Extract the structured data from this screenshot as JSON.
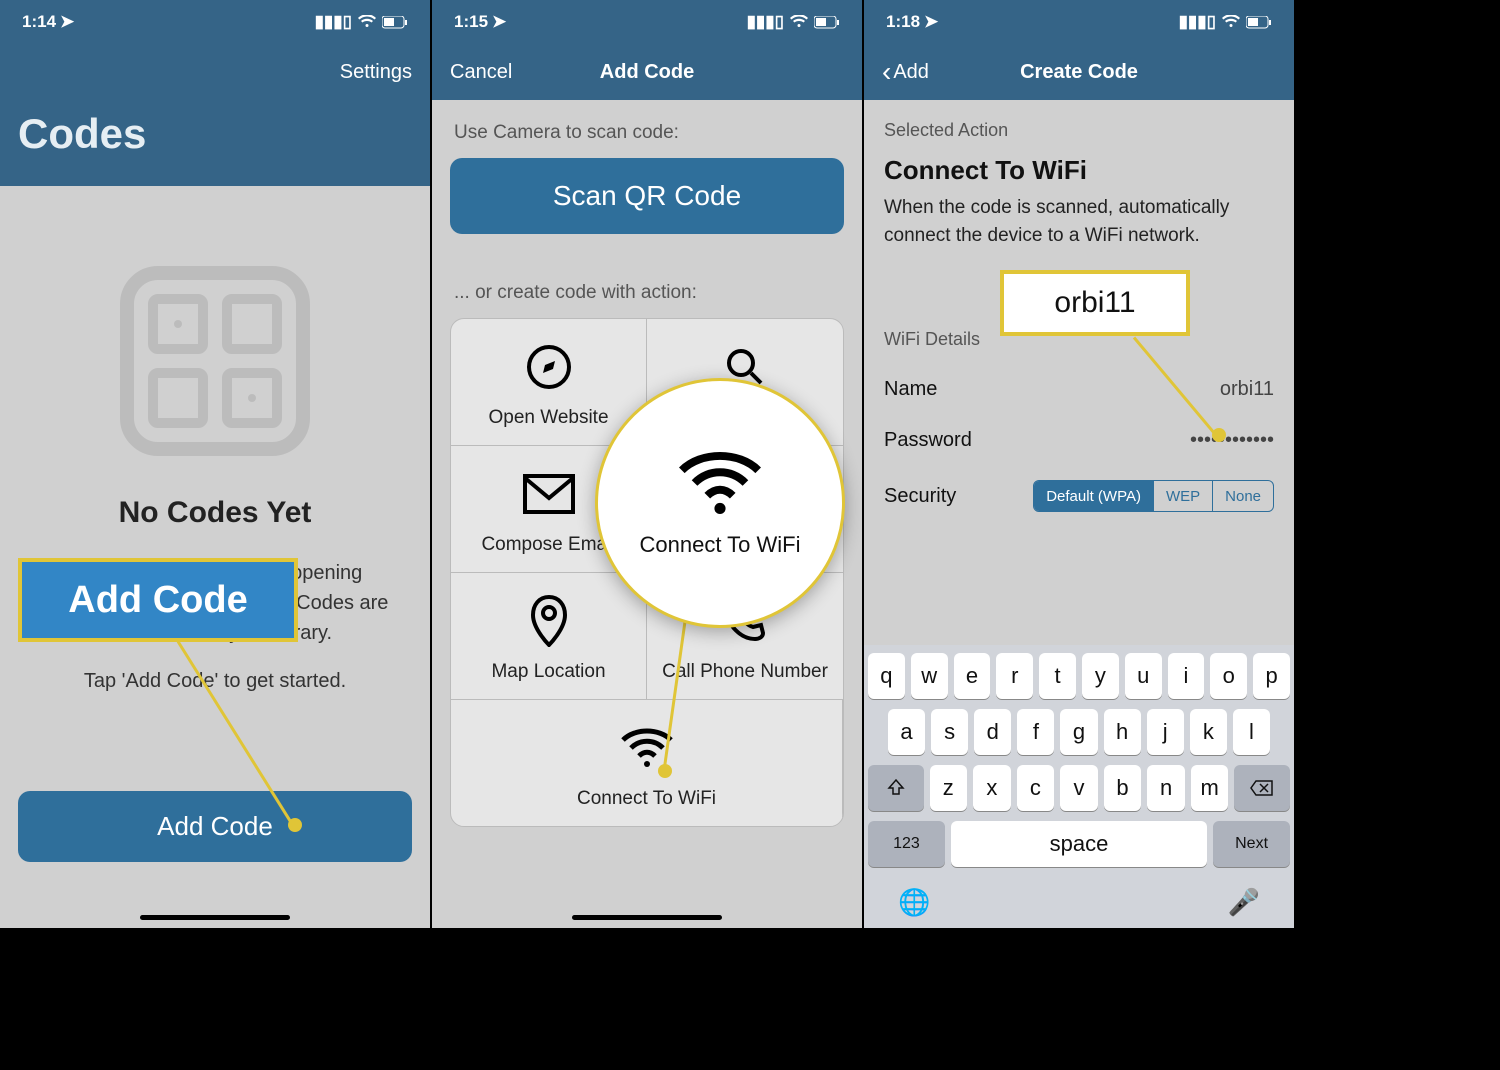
{
  "panel1": {
    "status_time": "1:14",
    "settings": "Settings",
    "title": "Codes",
    "empty_title": "No Codes Yet",
    "empty_desc": "Create custom codes for opening websites, paying, and more. Codes are saved here, in your library.",
    "empty_hint": "Tap 'Add Code' to get started.",
    "add_code_btn": "Add Code",
    "callout": "Add Code"
  },
  "panel2": {
    "status_time": "1:15",
    "cancel": "Cancel",
    "title": "Add Code",
    "scan_label": "Use Camera to scan code:",
    "scan_btn": "Scan QR Code",
    "create_label": "... or create code with action:",
    "actions": {
      "open_website": "Open Website",
      "compose_email": "Compose Email",
      "map_location": "Map Location",
      "call_phone": "Call Phone Number",
      "connect_wifi": "Connect To WiFi"
    },
    "zoom_label": "Connect To WiFi"
  },
  "panel3": {
    "status_time": "1:18",
    "back": "Add",
    "title": "Create Code",
    "selected_action_header": "Selected Action",
    "action_title": "Connect To WiFi",
    "action_desc": "When the code is scanned, automatically connect the device to a WiFi network.",
    "wifi_details_header": "WiFi Details",
    "name_label": "Name",
    "name_value": "orbi11",
    "password_label": "Password",
    "password_value": "••••••••••••",
    "security_label": "Security",
    "security_options": {
      "wpa": "Default (WPA)",
      "wep": "WEP",
      "none": "None"
    },
    "callout": "orbi11",
    "keyboard": {
      "row1": [
        "q",
        "w",
        "e",
        "r",
        "t",
        "y",
        "u",
        "i",
        "o",
        "p"
      ],
      "row2": [
        "a",
        "s",
        "d",
        "f",
        "g",
        "h",
        "j",
        "k",
        "l"
      ],
      "row3": [
        "z",
        "x",
        "c",
        "v",
        "b",
        "n",
        "m"
      ],
      "numbers": "123",
      "space": "space",
      "next": "Next"
    }
  }
}
